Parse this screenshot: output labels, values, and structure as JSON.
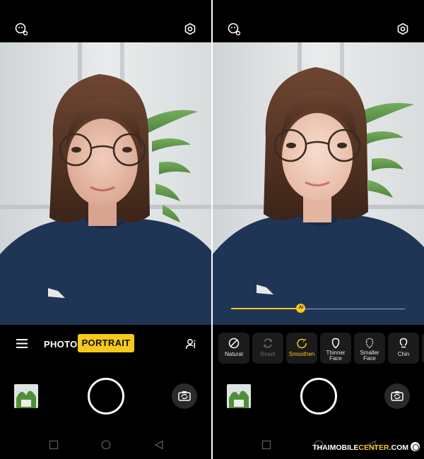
{
  "left": {
    "modes": {
      "photo": "PHOTO",
      "portrait": "PORTRAIT",
      "active": "PORTRAIT"
    },
    "icons": {
      "top_left": "beauty-face-icon",
      "top_right": "settings-icon",
      "menu": "menu-icon",
      "ai_portrait": "ai-portrait-icon",
      "switch_camera": "switch-camera-icon"
    }
  },
  "right": {
    "beauty_options": [
      {
        "label": "Natural",
        "icon": "no-filter-icon",
        "state": "normal"
      },
      {
        "label": "Reset",
        "icon": "reset-icon",
        "state": "disabled"
      },
      {
        "label": "Smoothen",
        "icon": "smoothen-icon",
        "state": "active"
      },
      {
        "label": "Thinner Face",
        "icon": "thin-face-icon",
        "state": "normal"
      },
      {
        "label": "Smaller Face",
        "icon": "small-face-icon",
        "state": "normal"
      },
      {
        "label": "Chin",
        "icon": "chin-icon",
        "state": "normal"
      }
    ],
    "slider": {
      "label": "AI",
      "value": 0.4
    },
    "icons": {
      "top_left": "beauty-face-icon",
      "top_right": "settings-icon",
      "switch_camera": "switch-camera-icon"
    }
  },
  "navbar": {
    "icons": [
      "recent-apps-icon",
      "home-icon",
      "back-icon"
    ]
  },
  "watermark": {
    "part1": "THAIMOBILE",
    "part2": "CENTER",
    "part3": ".COM"
  },
  "colors": {
    "accent": "#f7c81d",
    "background": "#000000",
    "sweater": "#1f3556"
  }
}
